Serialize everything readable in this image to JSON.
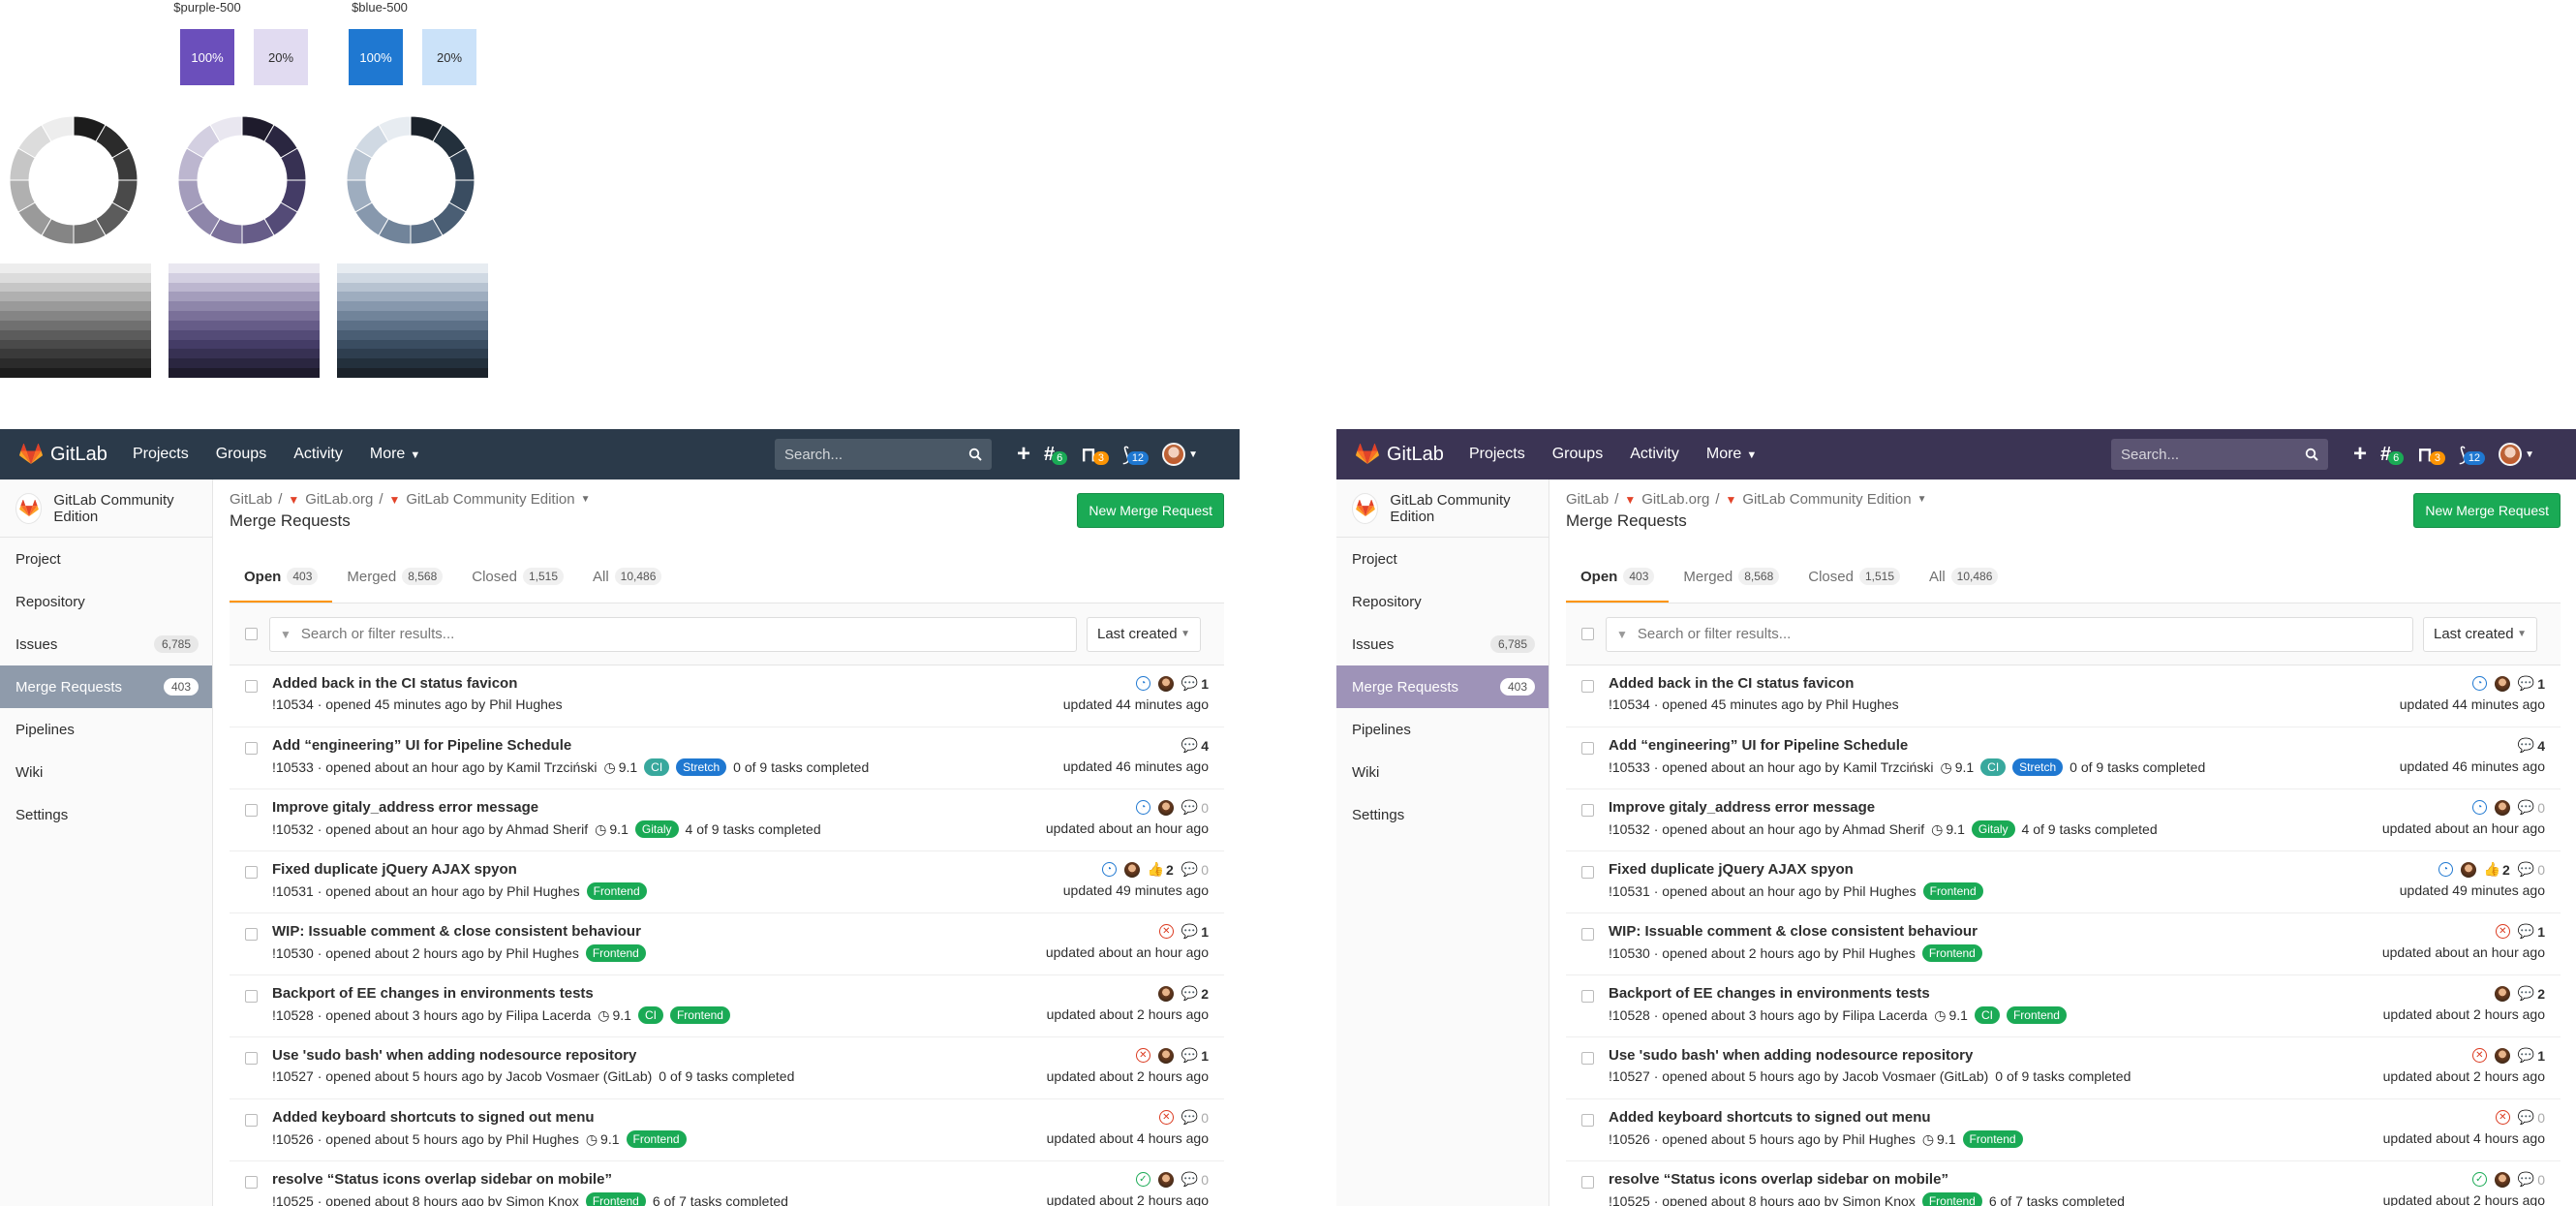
{
  "palette": {
    "purple_label": "$purple-500",
    "blue_label": "$blue-500",
    "swatches": [
      {
        "label": "100%",
        "color": "#6b4fbb",
        "text": "#ffffff"
      },
      {
        "label": "20%",
        "color": "#e1dbf1",
        "text": "#2e2e2e"
      },
      {
        "label": "100%",
        "color": "#1f78d1",
        "text": "#ffffff"
      },
      {
        "label": "20%",
        "color": "#cbe2f9",
        "text": "#2e2e2e"
      }
    ],
    "gray_scale": [
      "#1c1c1c",
      "#2b2b2b",
      "#3a3a3a",
      "#4a4a4a",
      "#5c5c5c",
      "#707070",
      "#858585",
      "#9a9a9a",
      "#b0b0b0",
      "#c6c6c6",
      "#dcdcdc",
      "#ededed"
    ],
    "purple_scale": [
      "#1e1b2c",
      "#2a2640",
      "#373153",
      "#443c66",
      "#544b77",
      "#665c88",
      "#7a7099",
      "#8e86aa",
      "#a49dbc",
      "#bcb6cf",
      "#d3cfe1",
      "#e9e7f0"
    ],
    "blue_scale": [
      "#1b222a",
      "#23303c",
      "#2e3e4f",
      "#3a4d61",
      "#4a5e74",
      "#5c7087",
      "#71849a",
      "#8798ad",
      "#9eadbf",
      "#b7c3d1",
      "#d0d9e3",
      "#e7ecf1"
    ]
  },
  "app": {
    "brand": "GitLab",
    "nav": {
      "projects": "Projects",
      "groups": "Groups",
      "activity": "Activity",
      "more": "More"
    },
    "search_placeholder": "Search...",
    "badges": {
      "todos": "6",
      "issues": "3",
      "mrs": "12"
    },
    "project_name": "GitLab Community Edition",
    "sidebar": [
      {
        "label": "Project",
        "count": ""
      },
      {
        "label": "Repository",
        "count": ""
      },
      {
        "label": "Issues",
        "count": "6,785"
      },
      {
        "label": "Merge Requests",
        "count": "403"
      },
      {
        "label": "Pipelines",
        "count": ""
      },
      {
        "label": "Wiki",
        "count": ""
      },
      {
        "label": "Settings",
        "count": ""
      }
    ],
    "breadcrumb": {
      "root": "GitLab",
      "group": "GitLab.org",
      "project": "GitLab Community Edition"
    },
    "page_title": "Merge Requests",
    "new_mr": "New Merge Request",
    "tabs": [
      {
        "label": "Open",
        "count": "403"
      },
      {
        "label": "Merged",
        "count": "8,568"
      },
      {
        "label": "Closed",
        "count": "1,515"
      },
      {
        "label": "All",
        "count": "10,486"
      }
    ],
    "filter_placeholder": "Search or filter results...",
    "sort": "Last created",
    "mrs": [
      {
        "title": "Added back in the CI status favicon",
        "iid": "!10534",
        "opened": "opened 45 minutes ago by",
        "author": "Phil Hughes",
        "milestone": "",
        "labels": [],
        "tasks": "",
        "ci": "run",
        "avatar": true,
        "upvotes": "",
        "comments": "1",
        "updated": "updated 44 minutes ago"
      },
      {
        "title": "Add “engineering” UI for Pipeline Schedule",
        "iid": "!10533",
        "opened": "opened about an hour ago by",
        "author": "Kamil Trzciński",
        "milestone": "9.1",
        "labels": [
          {
            "text": "CI",
            "color": "#38a89d"
          },
          {
            "text": "Stretch",
            "color": "#1f78d1"
          }
        ],
        "tasks": "0 of 9 tasks completed",
        "ci": "",
        "avatar": false,
        "upvotes": "",
        "comments": "4",
        "updated": "updated 46 minutes ago"
      },
      {
        "title": "Improve gitaly_address error message",
        "iid": "!10532",
        "opened": "opened about an hour ago by",
        "author": "Ahmad Sherif",
        "milestone": "9.1",
        "labels": [
          {
            "text": "Gitaly",
            "color": "#1aaa55"
          }
        ],
        "tasks": "4 of 9 tasks completed",
        "ci": "run",
        "avatar": true,
        "upvotes": "",
        "comments": "0",
        "updated": "updated about an hour ago"
      },
      {
        "title": "Fixed duplicate jQuery AJAX spyon",
        "iid": "!10531",
        "opened": "opened about an hour ago by",
        "author": "Phil Hughes",
        "milestone": "",
        "labels": [
          {
            "text": "Frontend",
            "color": "#1aaa55"
          }
        ],
        "tasks": "",
        "ci": "run",
        "avatar": true,
        "upvotes": "2",
        "comments": "0",
        "updated": "updated 49 minutes ago"
      },
      {
        "title": "WIP: Issuable comment & close consistent behaviour",
        "iid": "!10530",
        "opened": "opened about 2 hours ago by",
        "author": "Phil Hughes",
        "milestone": "",
        "labels": [
          {
            "text": "Frontend",
            "color": "#1aaa55"
          }
        ],
        "tasks": "",
        "ci": "fail",
        "avatar": false,
        "upvotes": "",
        "comments": "1",
        "updated": "updated about an hour ago"
      },
      {
        "title": "Backport of EE changes in environments tests",
        "iid": "!10528",
        "opened": "opened about 3 hours ago by",
        "author": "Filipa Lacerda",
        "milestone": "9.1",
        "labels": [
          {
            "text": "CI",
            "color": "#1aaa55"
          },
          {
            "text": "Frontend",
            "color": "#1aaa55"
          }
        ],
        "tasks": "",
        "ci": "",
        "avatar": true,
        "upvotes": "",
        "comments": "2",
        "updated": "updated about 2 hours ago"
      },
      {
        "title": "Use 'sudo bash' when adding nodesource repository",
        "iid": "!10527",
        "opened": "opened about 5 hours ago by",
        "author": "Jacob Vosmaer (GitLab)",
        "milestone": "",
        "labels": [],
        "tasks": "0 of 9 tasks completed",
        "ci": "fail",
        "avatar": true,
        "upvotes": "",
        "comments": "1",
        "updated": "updated about 2 hours ago"
      },
      {
        "title": "Added keyboard shortcuts to signed out menu",
        "iid": "!10526",
        "opened": "opened about 5 hours ago by",
        "author": "Phil Hughes",
        "milestone": "9.1",
        "labels": [
          {
            "text": "Frontend",
            "color": "#1aaa55"
          }
        ],
        "tasks": "",
        "ci": "fail",
        "avatar": false,
        "upvotes": "",
        "comments": "0",
        "updated": "updated about 4 hours ago"
      },
      {
        "title": "resolve “Status icons overlap sidebar on mobile”",
        "iid": "!10525",
        "opened": "opened about 8 hours ago by",
        "author": "Simon Knox",
        "milestone": "",
        "labels": [
          {
            "text": "Frontend",
            "color": "#1aaa55"
          }
        ],
        "tasks": "6 of 7 tasks completed",
        "ci": "ok",
        "avatar": true,
        "upvotes": "",
        "comments": "0",
        "updated": "updated about 2 hours ago"
      }
    ]
  },
  "themes": [
    {
      "nav_bg": "#2b3a4a",
      "search_bg": "#4a5866",
      "active_bg": "#8f9bab"
    },
    {
      "nav_bg": "#3b3454",
      "search_bg": "#5b5472",
      "active_bg": "#9e93b8"
    }
  ],
  "colors": {
    "open_tab_underline": "#fc9403",
    "new_mr_button": "#1aaa55",
    "gitlab_orange": "#e24329"
  }
}
